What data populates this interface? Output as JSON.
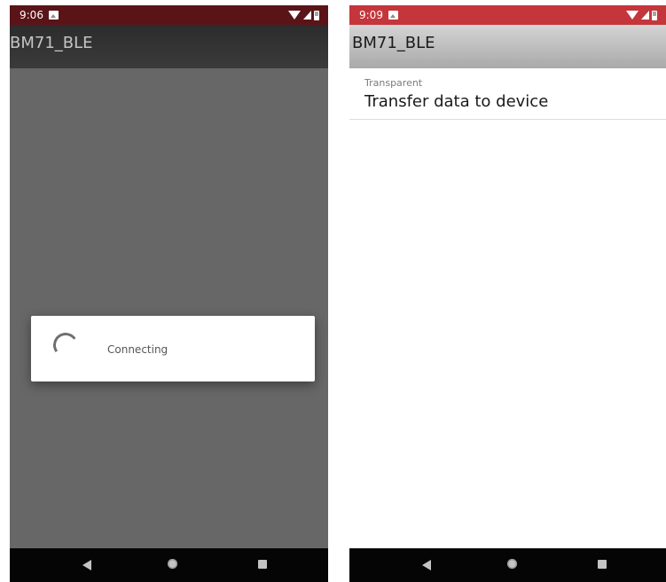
{
  "left_screen": {
    "status_bar": {
      "time": "9:06",
      "notification_icon": "image-icon",
      "system_icons": [
        "wifi-icon",
        "signal-icon",
        "battery-icon"
      ],
      "color": "#5a1418"
    },
    "app_bar": {
      "title": "BM71_BLE"
    },
    "dialog": {
      "message": "Connecting",
      "spinner_icon": "progress-spinner-icon"
    },
    "nav_bar": {
      "buttons": [
        "back",
        "home",
        "recents"
      ]
    }
  },
  "right_screen": {
    "status_bar": {
      "time": "9:09",
      "notification_icon": "image-icon",
      "system_icons": [
        "wifi-icon",
        "signal-icon",
        "battery-icon"
      ],
      "color": "#c4363c"
    },
    "app_bar": {
      "title": "BM71_BLE"
    },
    "list": [
      {
        "label": "Transparent",
        "value": "Transfer data to device"
      }
    ],
    "nav_bar": {
      "buttons": [
        "back",
        "home",
        "recents"
      ]
    }
  }
}
